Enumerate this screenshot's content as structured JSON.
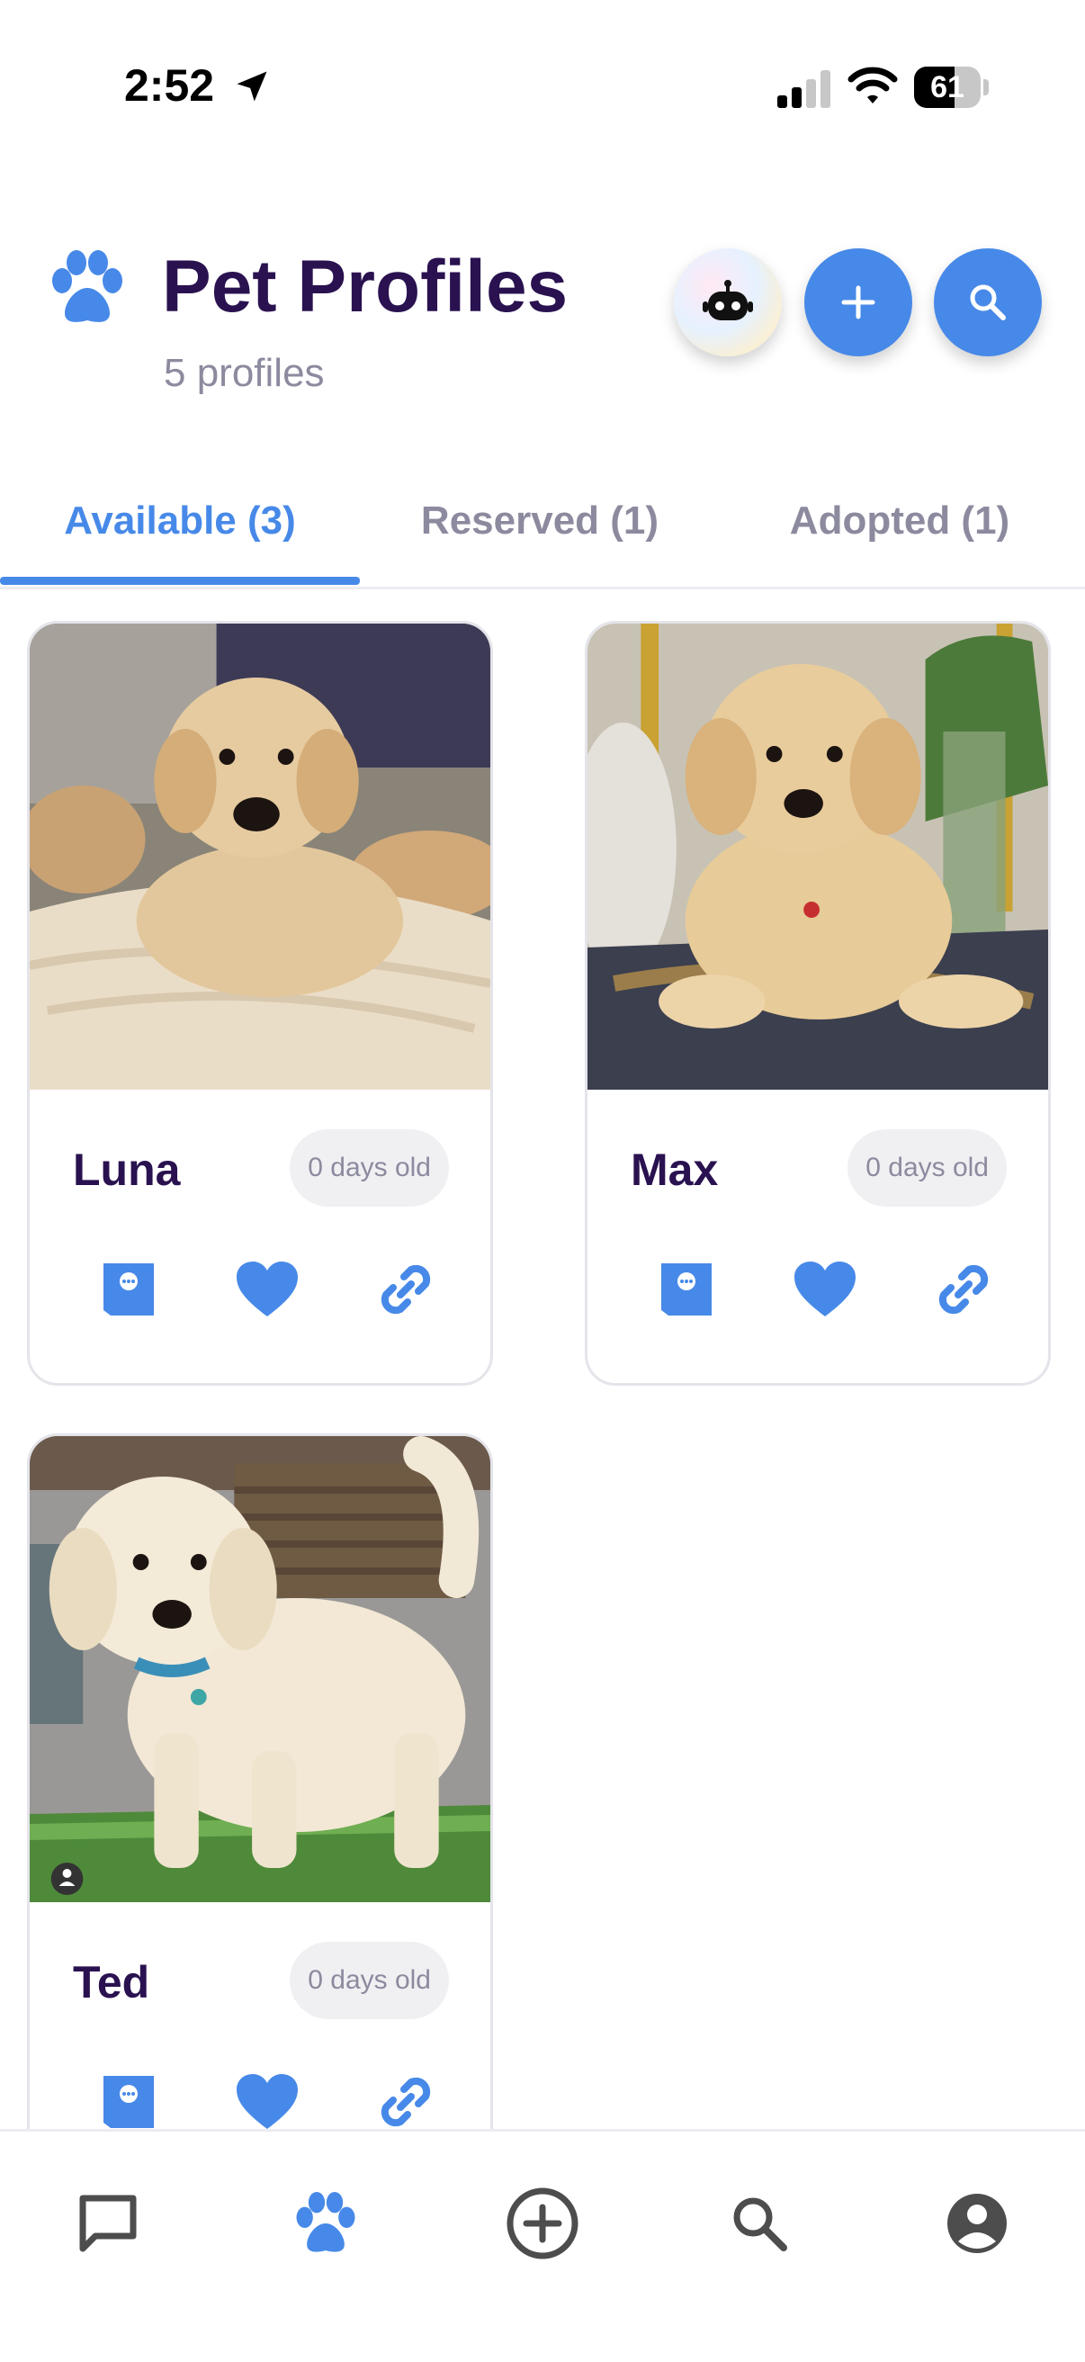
{
  "status_bar": {
    "time": "2:52",
    "battery": "61",
    "battery_level": 0.61
  },
  "header": {
    "title": "Pet Profiles",
    "subtitle": "5 profiles"
  },
  "header_actions": [
    {
      "name": "ai-assistant-button",
      "icon": "robot-icon"
    },
    {
      "name": "add-profile-button",
      "icon": "plus-icon"
    },
    {
      "name": "search-button",
      "icon": "search-icon"
    }
  ],
  "tabs": [
    {
      "label": "Available (3)",
      "active": true
    },
    {
      "label": "Reserved (1)",
      "active": false
    },
    {
      "label": "Adopted (1)",
      "active": false
    }
  ],
  "pets": [
    {
      "name": "Luna",
      "age": "0 days old"
    },
    {
      "name": "Max",
      "age": "0 days old"
    },
    {
      "name": "Ted",
      "age": "0 days old"
    }
  ],
  "card_actions": [
    "message-icon",
    "heart-icon",
    "link-icon"
  ],
  "bottom_nav": [
    "chat-icon",
    "paw-icon",
    "add-circle-icon",
    "search-icon",
    "account-icon"
  ],
  "colors": {
    "accent": "#4789e8",
    "title": "#2a1250",
    "muted": "#8c8a9e",
    "nav_icon": "#4d4d4d"
  }
}
